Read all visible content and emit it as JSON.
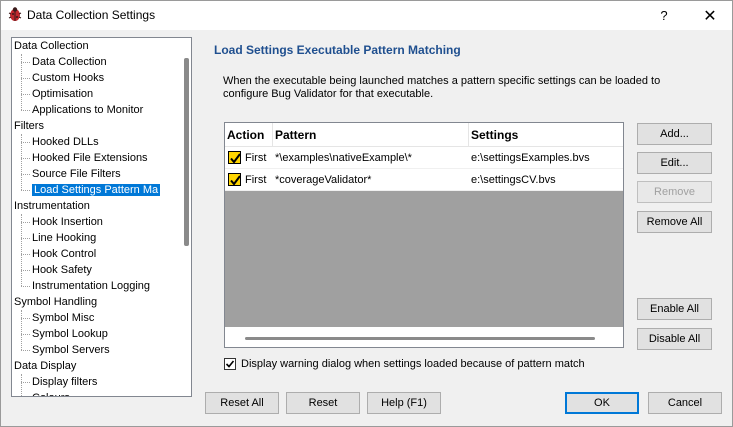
{
  "window": {
    "title": "Data Collection Settings",
    "help_label": "?",
    "close_label": "✕"
  },
  "tree": {
    "items": [
      {
        "label": "Data Collection",
        "level": 0
      },
      {
        "label": "Data Collection",
        "level": 1
      },
      {
        "label": "Custom Hooks",
        "level": 1
      },
      {
        "label": "Optimisation",
        "level": 1
      },
      {
        "label": "Applications to Monitor",
        "level": 1
      },
      {
        "label": "Filters",
        "level": 0
      },
      {
        "label": "Hooked DLLs",
        "level": 1
      },
      {
        "label": "Hooked File Extensions",
        "level": 1
      },
      {
        "label": "Source File Filters",
        "level": 1
      },
      {
        "label": "Load Settings Pattern Ma",
        "level": 1,
        "selected": true
      },
      {
        "label": "Instrumentation",
        "level": 0
      },
      {
        "label": "Hook Insertion",
        "level": 1
      },
      {
        "label": "Line Hooking",
        "level": 1
      },
      {
        "label": "Hook Control",
        "level": 1
      },
      {
        "label": "Hook Safety",
        "level": 1
      },
      {
        "label": "Instrumentation Logging",
        "level": 1
      },
      {
        "label": "Symbol Handling",
        "level": 0
      },
      {
        "label": "Symbol Misc",
        "level": 1
      },
      {
        "label": "Symbol Lookup",
        "level": 1
      },
      {
        "label": "Symbol Servers",
        "level": 1
      },
      {
        "label": "Data Display",
        "level": 0
      },
      {
        "label": "Display filters",
        "level": 1
      },
      {
        "label": "Colours",
        "level": 1
      }
    ]
  },
  "panel": {
    "title": "Load Settings Executable Pattern Matching",
    "description": "When the executable being launched matches a pattern specific settings can be loaded to configure Bug Validator for that executable."
  },
  "table": {
    "columns": [
      "Action",
      "Pattern",
      "Settings"
    ],
    "rows": [
      {
        "checked": true,
        "action": "First",
        "pattern": "*\\examples\\nativeExample\\*",
        "settings": "e:\\settingsExamples.bvs"
      },
      {
        "checked": true,
        "action": "First",
        "pattern": "*coverageValidator*",
        "settings": "e:\\settingsCV.bvs"
      }
    ]
  },
  "side_buttons": {
    "add": "Add...",
    "edit": "Edit...",
    "remove": "Remove",
    "remove_all": "Remove All",
    "enable_all": "Enable All",
    "disable_all": "Disable All"
  },
  "warning_checkbox": {
    "checked": true,
    "label": "Display warning dialog when settings loaded because of pattern match"
  },
  "bottom_buttons": {
    "reset_all": "Reset All",
    "reset": "Reset",
    "help": "Help (F1)",
    "ok": "OK",
    "cancel": "Cancel"
  },
  "colors": {
    "selection": "#0078d7",
    "section_title": "#1f4f8f",
    "checkbox_fill": "#ffd500"
  }
}
